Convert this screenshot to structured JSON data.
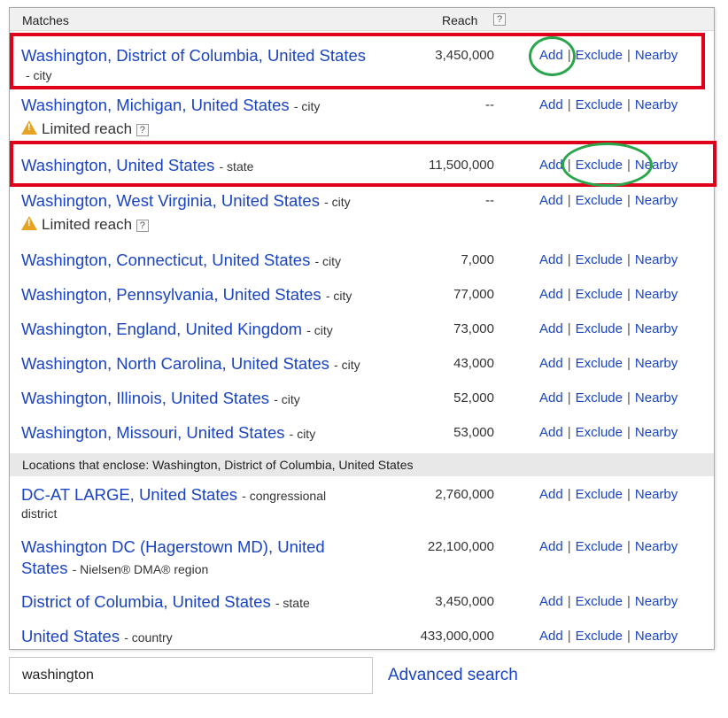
{
  "header": {
    "matches_label": "Matches",
    "reach_label": "Reach",
    "help_icon": "?"
  },
  "actions": {
    "add": "Add",
    "exclude": "Exclude",
    "nearby": "Nearby",
    "separator": "|"
  },
  "limited_reach_label": "Limited reach",
  "matches": [
    {
      "name": "Washington, District of Columbia, United States",
      "type": "- city",
      "reach": "3,450,000"
    },
    {
      "name": "Washington, Michigan, United States",
      "type": "- city",
      "reach": "--",
      "limited": true
    },
    {
      "name": "Washington, United States",
      "type": "- state",
      "reach": "11,500,000"
    },
    {
      "name": "Washington, West Virginia, United States",
      "type": "- city",
      "reach": "--",
      "limited": true
    },
    {
      "name": "Washington, Connecticut, United States",
      "type": "- city",
      "reach": "7,000"
    },
    {
      "name": "Washington, Pennsylvania, United States",
      "type": "- city",
      "reach": "77,000"
    },
    {
      "name": "Washington, England, United Kingdom",
      "type": "- city",
      "reach": "73,000"
    },
    {
      "name": "Washington, North Carolina, United States",
      "type": "- city",
      "reach": "43,000"
    },
    {
      "name": "Washington, Illinois, United States",
      "type": "- city",
      "reach": "52,000"
    },
    {
      "name": "Washington, Missouri, United States",
      "type": "- city",
      "reach": "53,000"
    }
  ],
  "enclosing_header": "Locations that enclose: Washington, District of Columbia, United States",
  "enclosing": [
    {
      "name": "DC-AT LARGE, United States",
      "type": "- congressional",
      "type_cont": "district",
      "reach": "2,760,000"
    },
    {
      "name_line1": "Washington DC (Hagerstown MD), United",
      "name_line2": "States",
      "type": "- Nielsen® DMA® region",
      "reach": "22,100,000"
    },
    {
      "name": "District of Columbia, United States",
      "type": "- state",
      "reach": "3,450,000"
    },
    {
      "name": "United States",
      "type": "- country",
      "reach": "433,000,000"
    }
  ],
  "search": {
    "value": "washington"
  },
  "advanced_search_label": "Advanced search",
  "colors": {
    "link": "#1a44c2",
    "highlight_red": "#e0001a",
    "highlight_green": "#2aa54a",
    "warning": "#e8a323"
  }
}
